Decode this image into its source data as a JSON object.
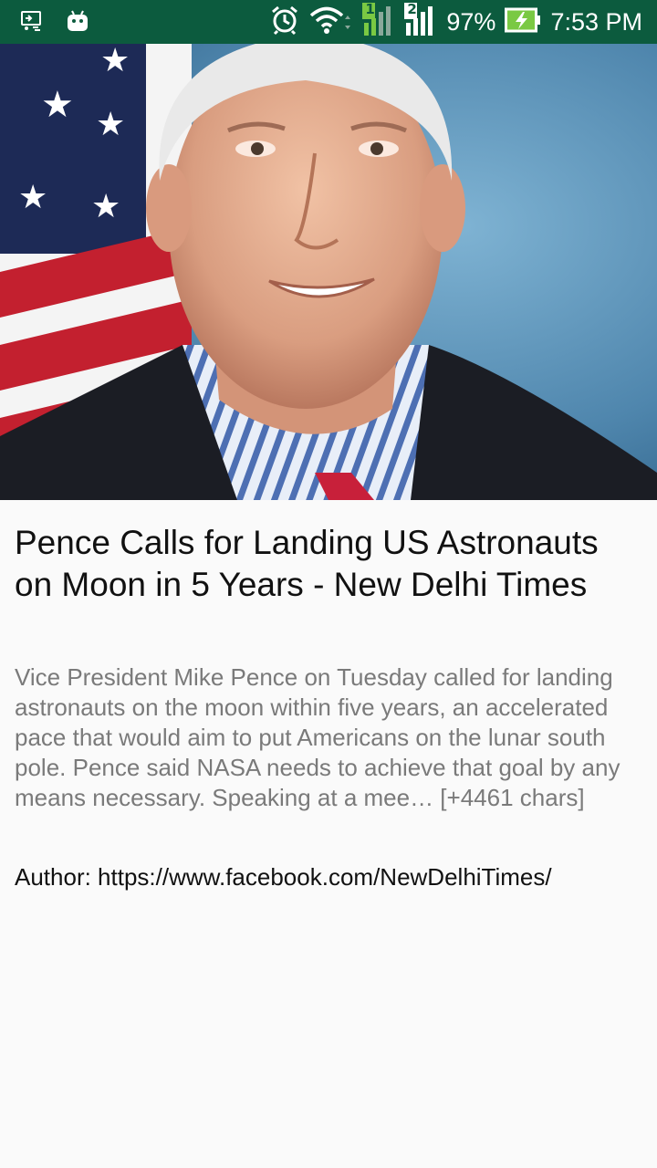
{
  "status_bar": {
    "battery_percent": "97%",
    "time": "7:53 PM",
    "sim1_label": "1",
    "sim2_label": "2",
    "icons": [
      "screen-cast-icon",
      "android-icon",
      "alarm-icon",
      "wifi-icon",
      "signal-sim1-icon",
      "signal-sim2-icon",
      "battery-charging-icon"
    ],
    "background_color": "#0c5b3e"
  },
  "article": {
    "image_description_icon": "portrait-photo",
    "title": "Pence Calls for Landing US Astronauts on Moon in 5 Years - New Delhi Times",
    "description": "Vice President Mike Pence on Tuesday called for landing astronauts on the moon within five years, an accelerated pace that would aim to put Americans on the lunar south pole. Pence said NASA needs to achieve that goal by any means necessary. Speaking at a mee… [+4461 chars]",
    "author": "Author: https://www.facebook.com/NewDelhiTimes/"
  }
}
